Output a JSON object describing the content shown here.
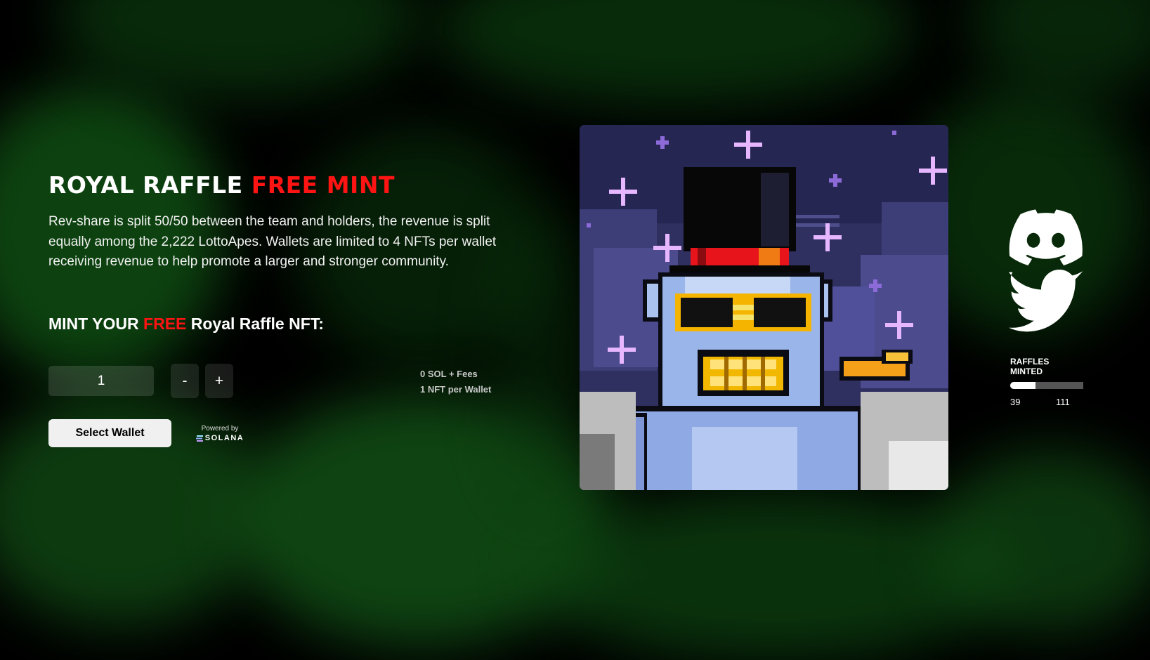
{
  "hero": {
    "title_main": "ROYAL RAFFLE ",
    "title_accent": "FREE MINT",
    "description": "Rev-share is split 50/50 between the team and holders, the revenue is split equally among the 2,222 LottoApes. Wallets are limited to 4 NFTs per wallet receiving revenue to help promote a larger and stronger community.",
    "subtitle_prefix": "MINT YOUR ",
    "subtitle_accent": "FREE",
    "subtitle_suffix": " Royal Raffle NFT:"
  },
  "mint": {
    "quantity": "1",
    "decrement_label": "-",
    "increment_label": "+",
    "price_label": "0 SOL + Fees",
    "limit_label": "1 NFT per Wallet",
    "select_wallet_label": "Select Wallet",
    "powered_by_label": "Powered by",
    "solana_label": "SOLANA"
  },
  "stats": {
    "label": "RAFFLES MINTED",
    "minted": "39",
    "total": "111",
    "progress_fraction": 0.35
  },
  "social": {
    "discord_icon": "discord-icon",
    "twitter_icon": "twitter-icon"
  },
  "colors": {
    "accent": "#ff1414",
    "background": "#000000",
    "smoke": "#1b5e1b"
  }
}
